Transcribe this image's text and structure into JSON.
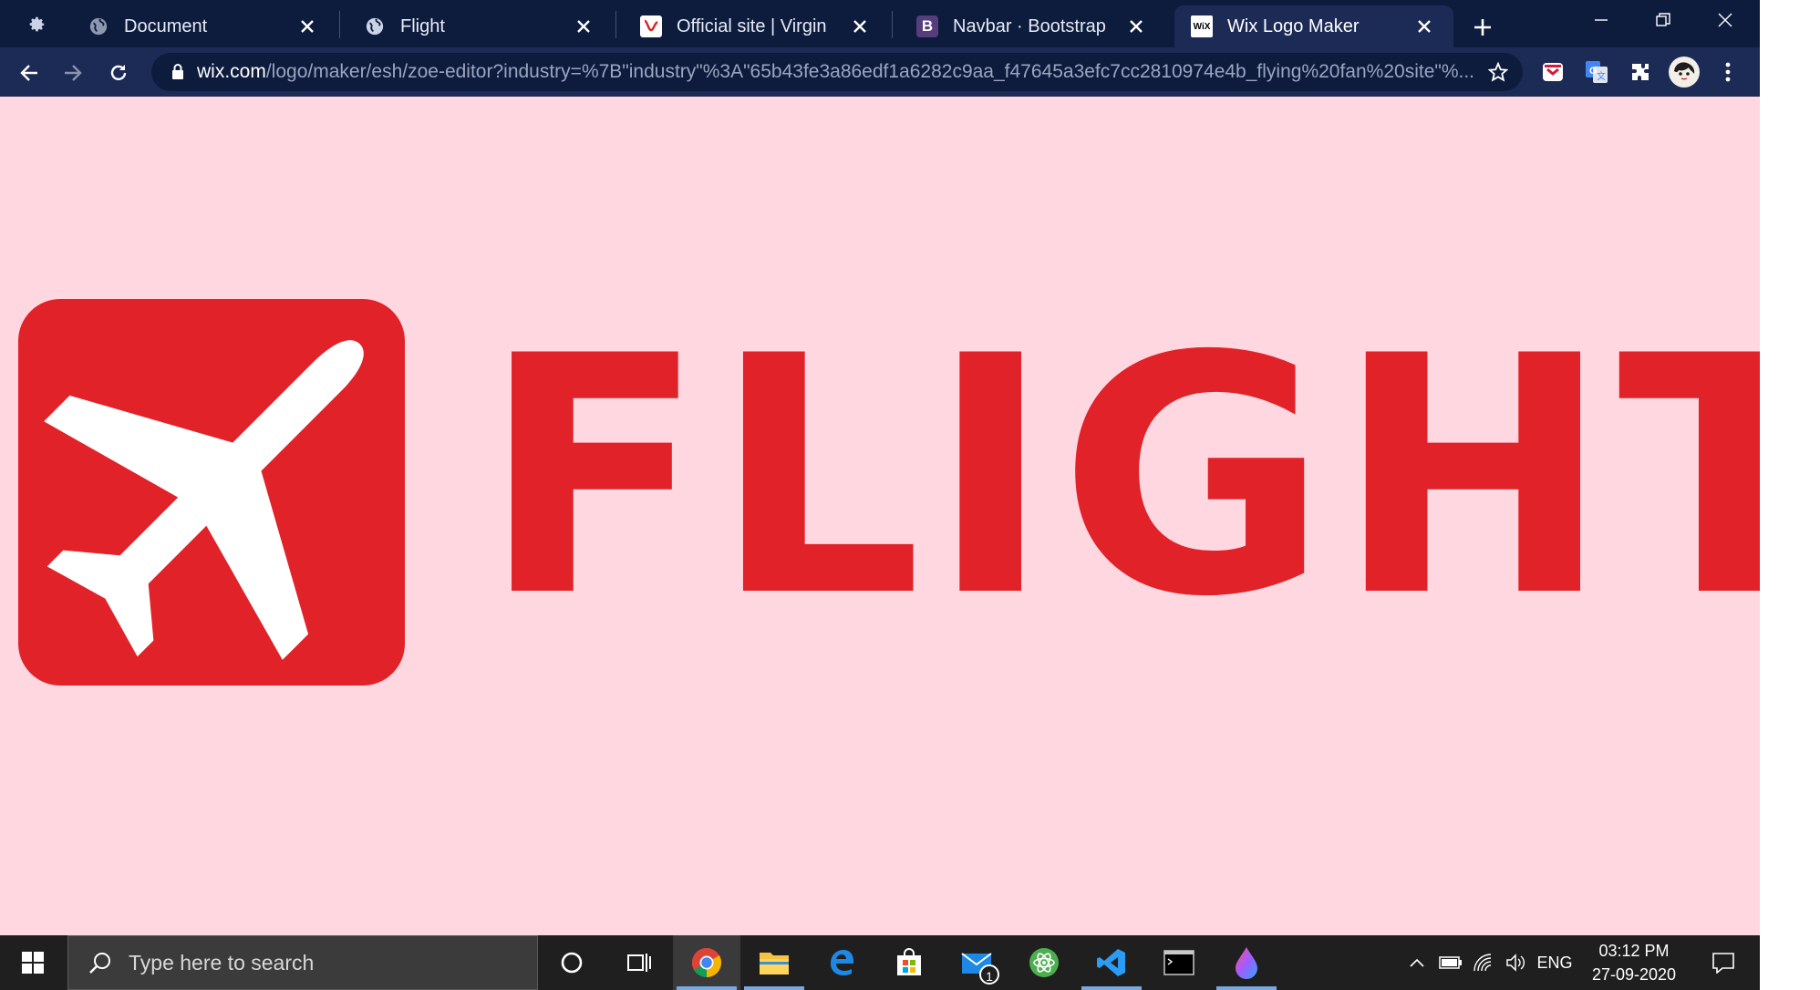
{
  "browser": {
    "tabs": [
      {
        "label": "Document",
        "favicon": "globe-icon",
        "active": false
      },
      {
        "label": "Flight",
        "favicon": "globe-icon",
        "active": false
      },
      {
        "label": "Official site | Virgin",
        "favicon": "virgin-icon",
        "active": false
      },
      {
        "label": "Navbar · Bootstrap",
        "favicon": "bootstrap-icon",
        "favicon_letter": "B",
        "active": false
      },
      {
        "label": "Wix Logo Maker",
        "favicon": "wix-icon",
        "favicon_letter": "WiX",
        "active": true
      }
    ],
    "url_host": "wix.com",
    "url_path": "/logo/maker/esh/zoe-editor?industry=%7B\"industry\"%3A\"65b43fe3a86edf1a6282c9aa_f47645a3efc7cc2810974e4b_flying%20fan%20site\"%..."
  },
  "page": {
    "logo_text": "FLIGHT",
    "logo_icon": "airplane-icon",
    "background": "#ffd7e0",
    "accent": "#e12228"
  },
  "taskbar": {
    "search_placeholder": "Type here to search",
    "apps": [
      "cortana-icon",
      "task-view-icon",
      "chrome-icon",
      "file-explorer-icon",
      "edge-icon",
      "store-icon",
      "mail-icon",
      "atom-icon",
      "vscode-icon",
      "terminal-icon",
      "paint-icon"
    ],
    "mail_badge": "1",
    "language": "ENG",
    "time": "03:12 PM",
    "date": "27-09-2020"
  }
}
